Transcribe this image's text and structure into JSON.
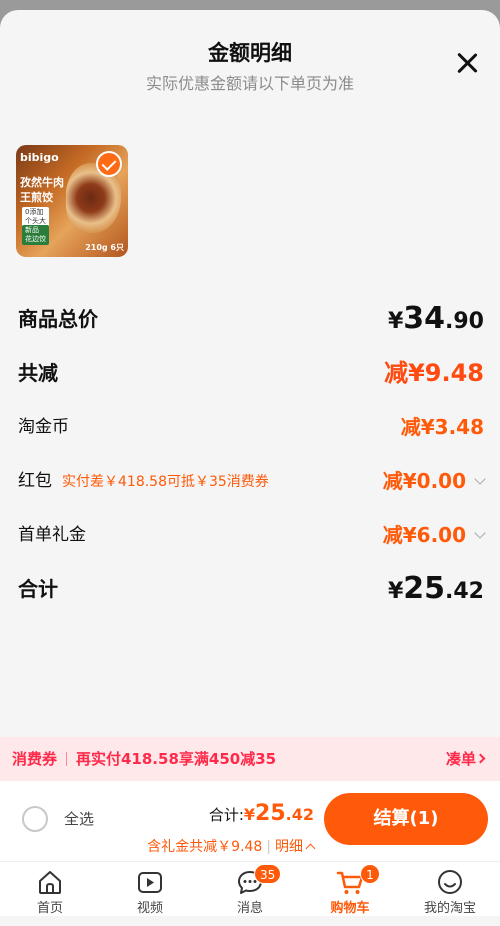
{
  "header": {
    "title": "金额明细",
    "subtitle": "实际优惠金额请以下单页为准"
  },
  "product": {
    "brand": "bibigo",
    "name_line1": "孜然牛肉",
    "name_line2": "王煎饺",
    "tag1_small": "0添加",
    "tag1": "个头大",
    "tag2_small": "新品",
    "tag2": "花边饺",
    "weight": "210g",
    "count": "6只",
    "selected": true
  },
  "rows": {
    "subtotal": {
      "label": "商品总价",
      "yuan": "¥",
      "int": "34",
      "dec": ".90"
    },
    "discount": {
      "label": "共减",
      "value": "减¥9.48"
    },
    "coins": {
      "label": "淘金币",
      "value": "减¥3.48"
    },
    "redpacket": {
      "label": "红包",
      "hint": "实付差￥418.58可抵￥35消费券",
      "value": "减¥0.00"
    },
    "firstorder": {
      "label": "首单礼金",
      "value": "减¥6.00"
    },
    "total": {
      "label": "合计",
      "yuan": "¥",
      "int": "25",
      "dec": ".42"
    }
  },
  "coupon_bar": {
    "tag": "消费券",
    "text": "再实付418.58享满450减35",
    "link": "凑单"
  },
  "checkout": {
    "select_all": "全选",
    "total_label": "合计:",
    "total_yuan": "¥",
    "total_int": "25",
    "total_dec": ".42",
    "savings": "含礼金共减￥9.48",
    "details": "明细",
    "pay_button": "结算(1)"
  },
  "tabs": [
    {
      "label": "首页",
      "icon": "home-icon"
    },
    {
      "label": "视频",
      "icon": "video-icon"
    },
    {
      "label": "消息",
      "icon": "message-icon",
      "badge": "35"
    },
    {
      "label": "购物车",
      "icon": "cart-icon",
      "badge": "1",
      "active": true
    },
    {
      "label": "我的淘宝",
      "icon": "profile-icon"
    }
  ],
  "colors": {
    "accent": "#ff5a0a",
    "coupon_bg": "#ffe8ea",
    "coupon_text": "#ff2a4a"
  }
}
